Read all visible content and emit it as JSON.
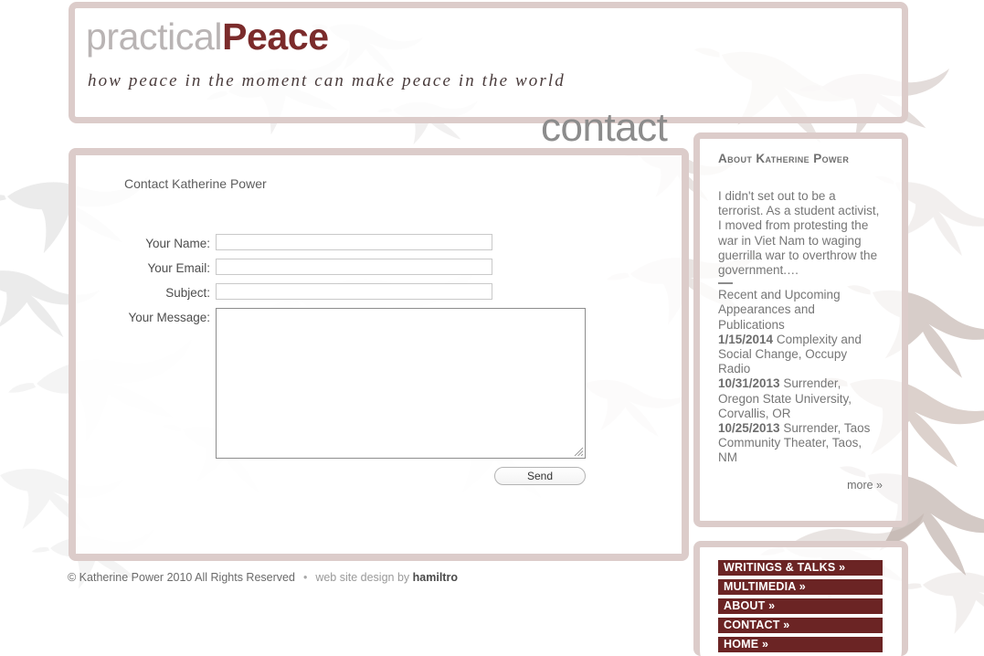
{
  "header": {
    "logo_light": "practical",
    "logo_bold": "Peace",
    "tagline": "how peace in the moment can make peace in the world"
  },
  "page_title": "contact",
  "main": {
    "heading": "Contact Katherine Power",
    "form": {
      "name_label": "Your Name:",
      "name_value": "",
      "email_label": "Your Email:",
      "email_value": "",
      "subject_label": "Subject:",
      "subject_value": "",
      "message_label": "Your Message:",
      "message_value": "",
      "send_label": "Send"
    }
  },
  "footer": {
    "copyright": "© Katherine Power 2010 All Rights Reserved",
    "separator": "•",
    "credit_prefix": "web site design by",
    "credit_link": "hamiltro"
  },
  "sidebar": {
    "about": {
      "title": "About Katherine Power",
      "bio": "I didn't set out to be a terrorist. As a student activist, I moved from protesting the war in Viet Nam to waging guerrilla war to overthrow the government.…",
      "events_heading": "Recent and Upcoming Appearances and Publications",
      "events": [
        {
          "date": "1/15/2014",
          "text": "Complexity and Social Change, Occupy Radio"
        },
        {
          "date": "10/31/2013",
          "text": "Surrender, Oregon State University, Corvallis, OR"
        },
        {
          "date": "10/25/2013",
          "text": "Surrender, Taos Community Theater, Taos, NM"
        }
      ],
      "more_label": "more »"
    },
    "nav": [
      {
        "label": "WRITINGS & TALKS »"
      },
      {
        "label": "MULTIMEDIA »"
      },
      {
        "label": "ABOUT »"
      },
      {
        "label": "CONTACT »"
      },
      {
        "label": "HOME »"
      }
    ]
  },
  "colors": {
    "frame_border": "#dcccca",
    "logo_accent": "#7b2b2b",
    "logo_muted": "#b9b4b4",
    "nav_bg": "#6b2424",
    "nav_text": "#ffffff",
    "title_gray": "#8c8c8c",
    "body_text": "#767676"
  }
}
